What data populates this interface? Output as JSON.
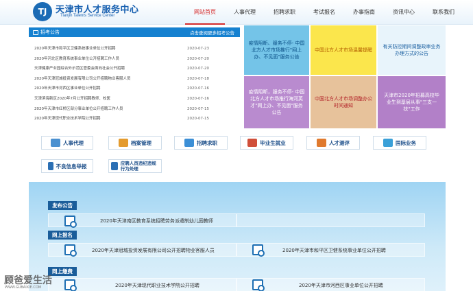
{
  "header": {
    "logo_text": "TJ",
    "title": "天津市人才服务中心",
    "subtitle": "Tianjin Talents Service Center",
    "nav": [
      "网站首页",
      "人事代理",
      "招聘求职",
      "考试报名",
      "办事指南",
      "资讯中心",
      "联系我们"
    ]
  },
  "notice": {
    "title": "招考公告",
    "more": "点击查阅更多招考公告",
    "items": [
      {
        "title": "2020年天津市和平区卫健系统事业单位公开招聘",
        "date": "2020-07-23"
      },
      {
        "title": "2020年河北区教育系统事业单位公开招聘工作人员",
        "date": "2020-07-20"
      },
      {
        "title": "天津健康产业园综合外示范区管委会面向社会公开招聘",
        "date": "2020-07-20"
      },
      {
        "title": "2020年天津冠城投资发展有限公司公开招聘物业客服人员",
        "date": "2020-07-18"
      },
      {
        "title": "2020年天津市河西区事业单位公开招聘",
        "date": "2020-07-16"
      },
      {
        "title": "天津滨海新区2020年7月公开招聘教师、校医",
        "date": "2020-07-16"
      },
      {
        "title": "2020年天津市红桥区部分事业单位公开招聘工作人员",
        "date": "2020-07-15"
      },
      {
        "title": "2020年天津现代职业技术学院公开招聘",
        "date": "2020-07-15"
      }
    ]
  },
  "tiles": [
    {
      "text": "疫情阻断、服务不停- 中国北方人才市场推行\"网上办、不见面\"服务公告",
      "style": "t-blue"
    },
    {
      "text": "中国北方人才市场温馨提醒",
      "style": "t-yellow"
    },
    {
      "text": "有关防控期间调整政审业务办理方式的公告",
      "style": "t-light"
    },
    {
      "text": "疫情阻断，服务不停- 中国北方人才市场推行海河英才\"网上办、不见面\"服务公告",
      "style": "t-purple"
    },
    {
      "text": "中国北方人才市场调整办公时间通知",
      "style": "t-tan"
    },
    {
      "text": "天津市2020年招募高校毕业生到基层从事\"三支一扶\"工作",
      "style": "t-purple2"
    }
  ],
  "quick": [
    {
      "label": "人事代理",
      "icon": "person-folder-icon",
      "color": "#4a90d0"
    },
    {
      "label": "档案管理",
      "icon": "archive-icon",
      "color": "#e49b2e"
    },
    {
      "label": "招聘求职",
      "icon": "recruit-icon",
      "color": "#3c8fd6"
    },
    {
      "label": "毕业生就业",
      "icon": "graduate-icon",
      "color": "#d04f3a"
    },
    {
      "label": "人才测评",
      "icon": "evaluation-icon",
      "color": "#e07a2e"
    },
    {
      "label": "国际业务",
      "icon": "globe-icon",
      "color": "#3aa0d8"
    },
    {
      "label": "不良信息举报",
      "icon": "phone-report-icon",
      "color": "#2b6fb4"
    },
    {
      "label": "应聘人员违纪违规行为处理",
      "icon": "document-icon",
      "color": "#2b6fb4"
    }
  ],
  "sections": {
    "publish": {
      "tag": "发布公告",
      "rows": [
        "2020年天津南区教育系统招聘劳务派遣制幼儿园教师"
      ]
    },
    "signup": {
      "tag": "网上报名",
      "rows": [
        "2020年天津冠城投资发展有限公司公开招聘物业客服人员",
        "2020年天津市和平区卫健系统事业单位公开招聘"
      ]
    },
    "pay": {
      "tag": "网上缴费",
      "rows": [
        "2020年天津现代职业技术学院公开招聘",
        "2020年天津市河西区事业单位公开招聘"
      ]
    }
  },
  "watermark": {
    "text": "顾爸爱生活",
    "url": "WWW.GUBAIXIE.COM"
  }
}
